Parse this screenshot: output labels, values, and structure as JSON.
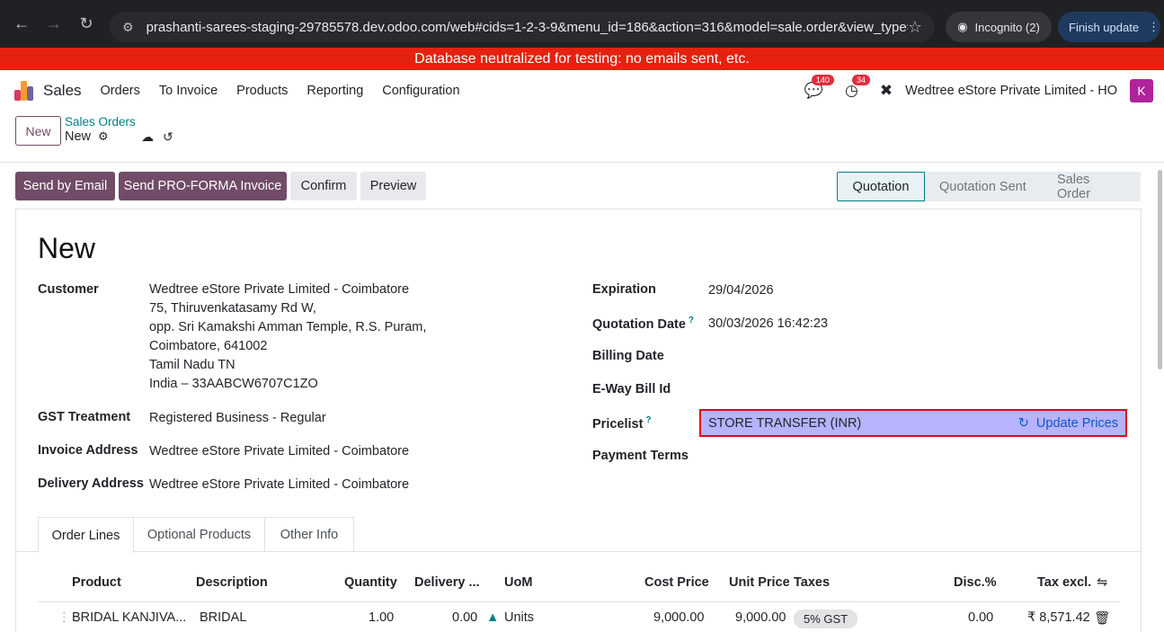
{
  "browser": {
    "url": "prashanti-sarees-staging-29785578.dev.odoo.com/web#cids=1-2-3-9&menu_id=186&action=316&model=sale.order&view_type=form",
    "incognito_label": "Incognito (2)",
    "finish_label": "Finish update"
  },
  "banner": "Database neutralized for testing: no emails sent, etc.",
  "nav": {
    "app": "Sales",
    "menu": [
      "Orders",
      "To Invoice",
      "Products",
      "Reporting",
      "Configuration"
    ],
    "messages_count": "140",
    "activities_count": "34",
    "company": "Wedtree eStore Private Limited - HO",
    "avatar": "K"
  },
  "control": {
    "new_label": "New",
    "breadcrumb": "Sales Orders",
    "record": "New"
  },
  "actions": {
    "send_email": "Send by Email",
    "send_proforma": "Send PRO-FORMA Invoice",
    "confirm": "Confirm",
    "preview": "Preview"
  },
  "stages": [
    "Quotation",
    "Quotation Sent",
    "Sales Order"
  ],
  "form": {
    "title": "New",
    "customer_label": "Customer",
    "customer_lines": [
      "Wedtree eStore Private Limited - Coimbatore",
      "75, Thiruvenkatasamy Rd W,",
      "opp. Sri Kamakshi Amman Temple, R.S. Puram,",
      "Coimbatore, 641002",
      "Tamil Nadu TN",
      "India – 33AABCW6707C1ZO"
    ],
    "gst_label": "GST Treatment",
    "gst_value": "Registered Business - Regular",
    "invoice_label": "Invoice Address",
    "invoice_value": "Wedtree eStore Private Limited - Coimbatore",
    "delivery_label": "Delivery Address",
    "delivery_value": "Wedtree eStore Private Limited - Coimbatore",
    "expiration_label": "Expiration",
    "expiration_value": "29/04/2026",
    "qdate_label": "Quotation Date",
    "qdate_value": "30/03/2026 16:42:23",
    "billing_label": "Billing Date",
    "eway_label": "E-Way Bill Id",
    "pricelist_label": "Pricelist",
    "pricelist_value": "STORE TRANSFER (INR)",
    "update_prices": "Update Prices",
    "payment_label": "Payment Terms",
    "help_mark": "?"
  },
  "tabs": [
    "Order Lines",
    "Optional Products",
    "Other Info"
  ],
  "table": {
    "headers": [
      "Product",
      "Description",
      "Quantity",
      "Delivery ...",
      "UoM",
      "Cost Price",
      "Unit Price",
      "Taxes",
      "Disc.%",
      "Tax excl."
    ],
    "rows": [
      {
        "product": "BRIDAL KANJIVA...",
        "description": "BRIDAL",
        "quantity": "1.00",
        "delivered": "0.00",
        "uom": "Units",
        "cost": "9,000.00",
        "unit_price": "9,000.00",
        "tax": "5% GST",
        "discount": "0.00",
        "subtotal": "₹ 8,571.42"
      }
    ]
  },
  "colors": {
    "brand": "#714b67",
    "accent": "#017e84",
    "banner": "#e4220f",
    "pricelist_highlight": "#b7b3ff",
    "pricelist_border": "#e0061b"
  }
}
